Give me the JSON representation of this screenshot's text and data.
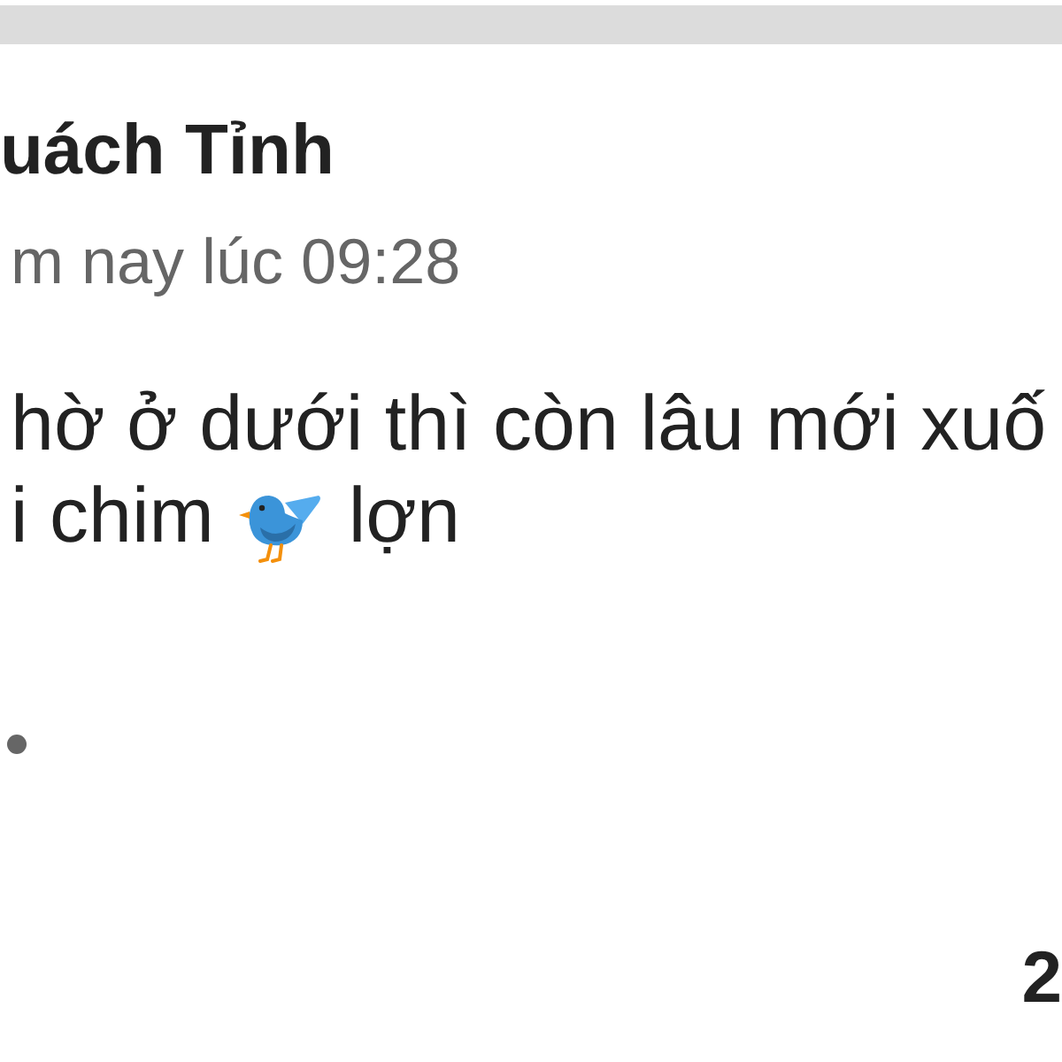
{
  "post": {
    "author": "uách Tỉnh",
    "time": "m nay lúc 09:28",
    "lines": [
      [
        {
          "kind": "text",
          "text": "hờ ở dưới thì còn lâu mới xuố"
        }
      ],
      [
        {
          "kind": "text",
          "text": "i chim"
        },
        {
          "kind": "emoji"
        },
        {
          "kind": "text",
          "text": "lợn"
        }
      ]
    ]
  },
  "footer": {
    "count": "2"
  }
}
